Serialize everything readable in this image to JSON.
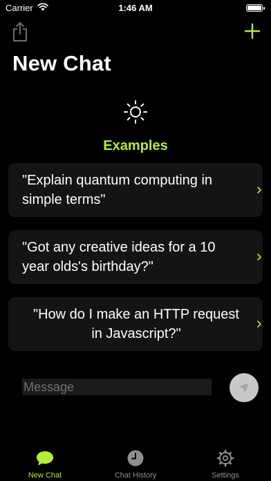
{
  "status_bar": {
    "carrier": "Carrier",
    "time": "1:46 AM"
  },
  "header": {
    "title": "New Chat"
  },
  "examples": {
    "title": "Examples",
    "items": [
      {
        "text": "\"Explain quantum computing in simple terms\""
      },
      {
        "text": "\"Got any creative ideas for a 10 year olds's birthday?\""
      },
      {
        "text": "\"How do I make an HTTP request in Javascript?\""
      }
    ]
  },
  "composer": {
    "placeholder": "Message"
  },
  "tabs": [
    {
      "label": "New Chat",
      "icon": "chat-bubble-icon",
      "active": true
    },
    {
      "label": "Chat History",
      "icon": "clock-icon",
      "active": false
    },
    {
      "label": "Settings",
      "icon": "gear-icon",
      "active": false
    }
  ],
  "colors": {
    "accent": "#b2ee3c",
    "background": "#000000",
    "card": "#141414"
  }
}
